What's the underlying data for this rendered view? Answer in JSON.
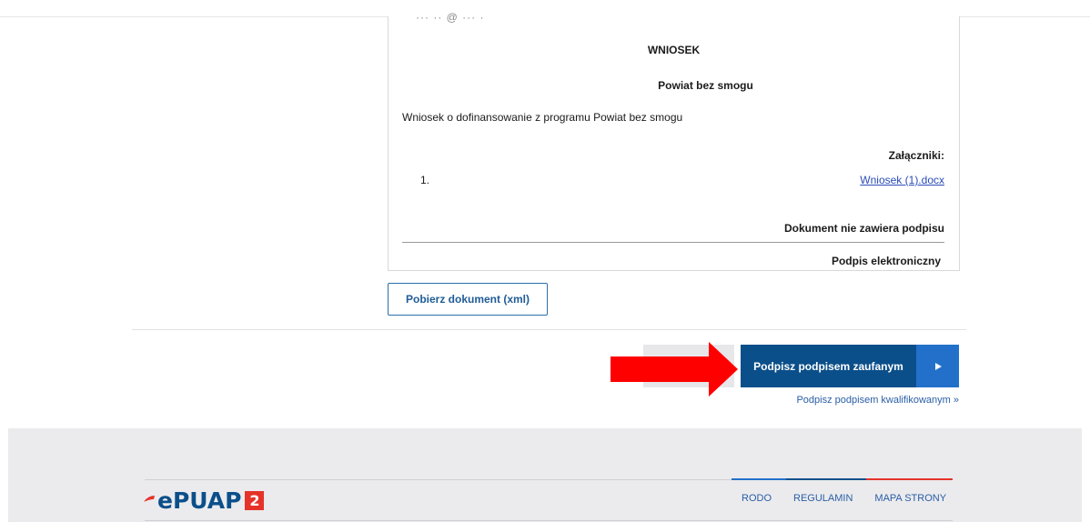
{
  "document": {
    "cut_text": "···  ·· @ ··· ·",
    "title": "WNIOSEK",
    "subtitle": "Powiat bez smogu",
    "description": "Wniosek o dofinansowanie z programu Powiat bez smogu",
    "attachments_heading": "Załączniki:",
    "attachments": [
      {
        "number": "1.",
        "name": "Wniosek (1).docx"
      }
    ],
    "no_signature_text": "Dokument nie zawiera podpisu",
    "e_signature_heading": "Podpis elektroniczny"
  },
  "actions": {
    "download_label": "Pobierz dokument (xml)",
    "sign_trusted_label": "Podpisz podpisem zaufanym",
    "sign_qualified_label": "Podpisz podpisem kwalifikowanym »"
  },
  "footer": {
    "logo_text": "ePUAP",
    "logo_badge": "2",
    "links": [
      "RODO",
      "REGULAMIN",
      "MAPA STRONY"
    ]
  },
  "colors": {
    "primary": "#0b4f8a",
    "play_segment": "#2270c9",
    "arrow": "#ff0000",
    "logo_red": "#e5332a",
    "link": "#2a5ea7"
  },
  "icons": {
    "play": "play-icon",
    "arrow": "arrow-right-icon"
  }
}
